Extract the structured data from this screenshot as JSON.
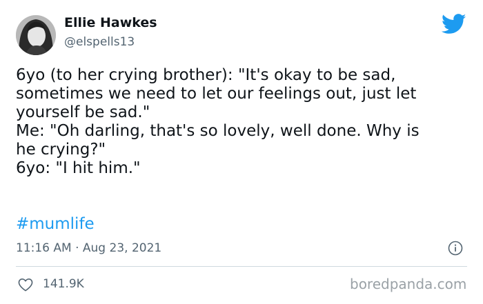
{
  "author": {
    "display_name": "Ellie Hawkes",
    "handle": "@elspells13"
  },
  "tweet": {
    "lines": [
      "6yo (to her crying brother): \"It's okay to be sad,",
      "sometimes we need to let our feelings out, just let",
      "yourself be sad.\"",
      "Me: \"Oh darling, that's so lovely, well done. Why is",
      "he crying?\"",
      "6yo: \"I hit him.\""
    ],
    "hashtag": "#mumlife",
    "timestamp": "11:16 AM · Aug 23, 2021"
  },
  "engagement": {
    "likes": "141.9K"
  },
  "watermark": "boredpanda.com",
  "icons": {
    "brand": "twitter-bird-icon",
    "info": "info-icon",
    "like": "heart-icon"
  },
  "colors": {
    "twitter_blue": "#1d9bf0",
    "text": "#0f1419",
    "secondary": "#536471",
    "divider": "#cfd9de"
  }
}
